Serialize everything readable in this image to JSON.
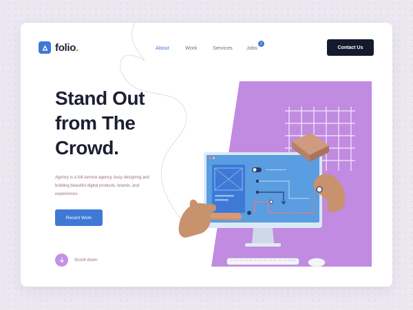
{
  "brand": {
    "name": "folio",
    "dot": ".",
    "accent": "#e46d3f",
    "primary": "#3f79d6"
  },
  "nav": {
    "items": [
      {
        "label": "About",
        "active": true
      },
      {
        "label": "Work",
        "active": false
      },
      {
        "label": "Services",
        "active": false
      },
      {
        "label": "Jobs",
        "active": false,
        "badge": "2"
      }
    ]
  },
  "header": {
    "cta_label": "Contact Us"
  },
  "hero": {
    "title_lines": [
      "Stand Out",
      "from The",
      "Crowd."
    ],
    "description": "Agency is a full-service agency, busy designing and building beautiful digital products, brands, and experiences.",
    "button_label": "Recent Work"
  },
  "scroll": {
    "label": "Scroll down",
    "icon": "arrow-down-icon"
  },
  "colors": {
    "dark": "#151a2e",
    "lilac": "#c391e6",
    "panel": "#c08be0",
    "monitor": "#5a9de0"
  },
  "illustration": {
    "icon": "desktop-monitor-illustration"
  }
}
